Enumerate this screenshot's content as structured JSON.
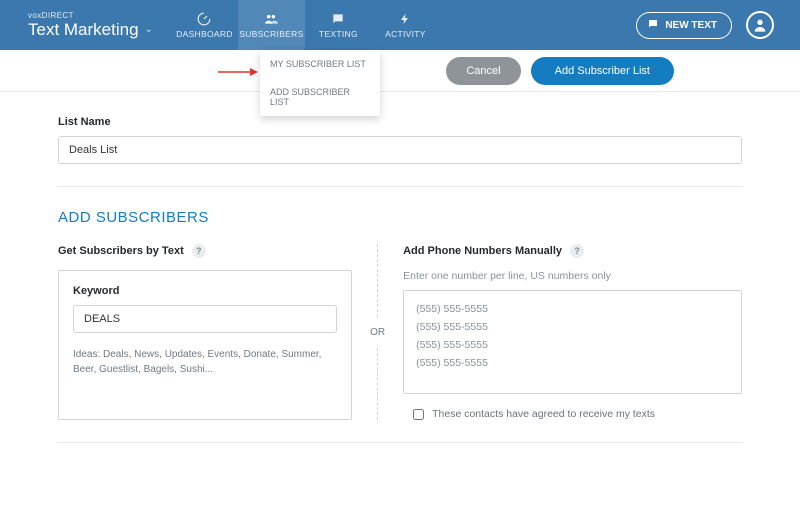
{
  "header": {
    "logo_small": "voxDIRECT",
    "logo_big": "Text Marketing",
    "nav": {
      "dashboard": "DASHBOARD",
      "subscribers": "SUBSCRIBERS",
      "texting": "TEXTING",
      "activity": "ACTIVITY"
    },
    "new_text": "NEW TEXT"
  },
  "dropdown": {
    "item1": "MY SUBSCRIBER LIST",
    "item2": "ADD SUBSCRIBER LIST"
  },
  "actions": {
    "cancel": "Cancel",
    "add_list": "Add Subscriber List"
  },
  "form": {
    "list_name_label": "List Name",
    "list_name_value": "Deals List",
    "section_title": "ADD SUBSCRIBERS",
    "get_by_text": "Get Subscribers by Text",
    "keyword_label": "Keyword",
    "keyword_value": "DEALS",
    "ideas": "Ideas: Deals, News, Updates, Events, Donate, Summer, Beer, Guestlist, Bagels, Sushi...",
    "or": "OR",
    "add_manual": "Add Phone Numbers Manually",
    "manual_hint": "Enter one number per line, US numbers only",
    "sample_numbers": "(555) 555-5555\n(555) 555-5555\n(555) 555-5555\n(555) 555-5555",
    "consent": "These contacts have agreed to receive my texts",
    "help": "?"
  }
}
